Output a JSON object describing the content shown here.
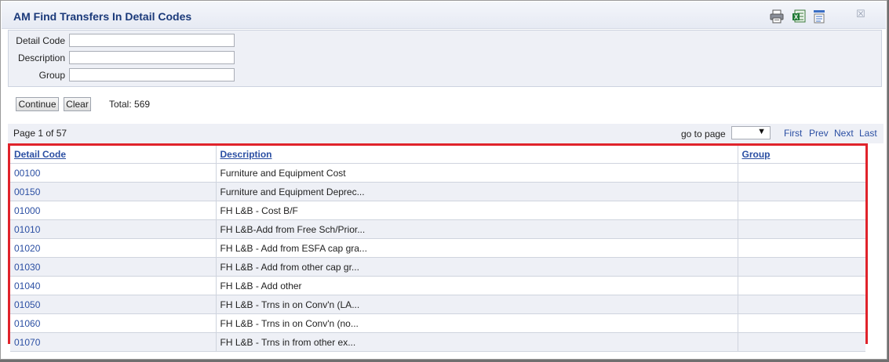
{
  "dialog": {
    "title": "AM Find Transfers In Detail Codes",
    "icons": [
      "print-icon",
      "excel-export-icon",
      "document-icon",
      "close-icon"
    ],
    "close_glyph": "☒"
  },
  "search": {
    "fields": [
      {
        "label": "Detail Code",
        "value": ""
      },
      {
        "label": "Description",
        "value": ""
      },
      {
        "label": "Group",
        "value": ""
      }
    ],
    "continue_label": "Continue",
    "clear_label": "Clear",
    "total_text": "Total: 569"
  },
  "pager": {
    "page_info": "Page 1 of 57",
    "goto_label": "go to page",
    "goto_value": "",
    "first": "First",
    "prev": "Prev",
    "next": "Next",
    "last": "Last"
  },
  "table": {
    "columns": [
      "Detail Code",
      "Description",
      "Group"
    ],
    "rows": [
      {
        "code": "00100",
        "description": "Furniture and Equipment Cost",
        "group": ""
      },
      {
        "code": "00150",
        "description": "Furniture and Equipment Deprec...",
        "group": ""
      },
      {
        "code": "01000",
        "description": "FH L&B - Cost B/F",
        "group": ""
      },
      {
        "code": "01010",
        "description": "FH L&B-Add from Free Sch/Prior...",
        "group": ""
      },
      {
        "code": "01020",
        "description": "FH L&B - Add from ESFA cap gra...",
        "group": ""
      },
      {
        "code": "01030",
        "description": "FH L&B - Add from other cap gr...",
        "group": ""
      },
      {
        "code": "01040",
        "description": "FH L&B - Add other",
        "group": ""
      },
      {
        "code": "01050",
        "description": "FH L&B - Trns in on Conv'n (LA...",
        "group": ""
      },
      {
        "code": "01060",
        "description": "FH L&B - Trns in on Conv'n (no...",
        "group": ""
      },
      {
        "code": "01070",
        "description": "FH L&B - Trns in from other ex...",
        "group": ""
      }
    ]
  },
  "colors": {
    "link": "#2b4fa3",
    "highlight_border": "#e0232b",
    "row_alt": "#eef0f6"
  }
}
